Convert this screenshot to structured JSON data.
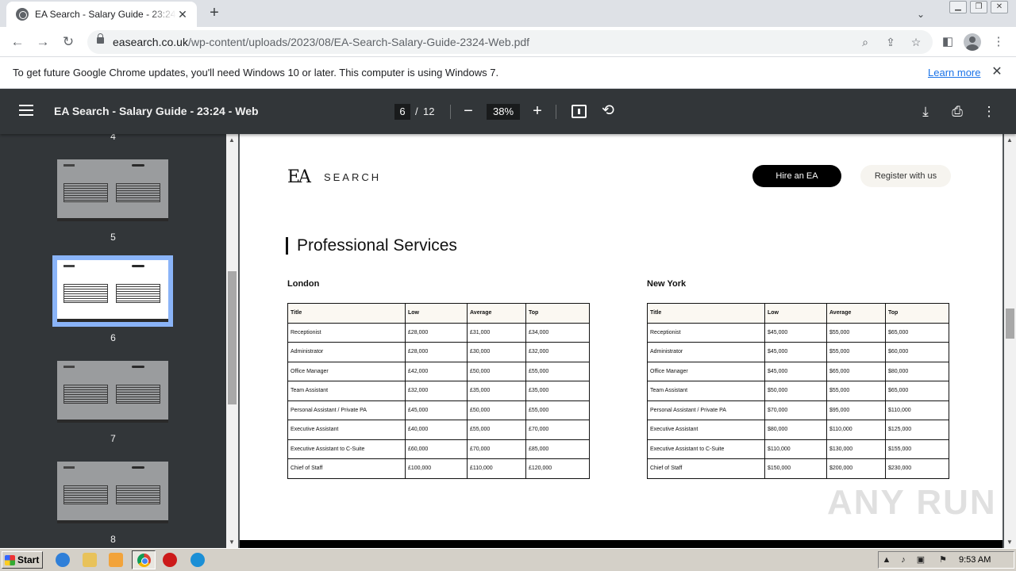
{
  "browser": {
    "tab_title": "EA Search - Salary Guide - 23:24 - Web",
    "tab_close": "✕",
    "new_tab": "+",
    "url_host": "easearch.co.uk",
    "url_path": "/wp-content/uploads/2023/08/EA-Search-Salary-Guide-2324-Web.pdf"
  },
  "infobar": {
    "message": "To get future Google Chrome updates, you'll need Windows 10 or later. This computer is using Windows 7.",
    "link": "Learn more"
  },
  "pdf_toolbar": {
    "title": "EA Search - Salary Guide - 23:24 - Web",
    "current_page": "6",
    "page_sep": "/",
    "total_pages": "12",
    "zoom": "38%",
    "zoom_out": "−",
    "zoom_in": "+"
  },
  "sidebar": {
    "thumbs": [
      {
        "label": "4"
      },
      {
        "label": "5"
      },
      {
        "label": "6"
      },
      {
        "label": "7"
      },
      {
        "label": "8"
      }
    ],
    "selected": "6"
  },
  "page": {
    "brand_mark": "EA",
    "brand_name": "SEARCH",
    "hire_button": "Hire an EA",
    "register_button": "Register with us",
    "section_title": "Professional Services",
    "tables": [
      {
        "city": "London",
        "headers": [
          "Title",
          "Low",
          "Average",
          "Top"
        ],
        "rows": [
          [
            "Receptionist",
            "£28,000",
            "£31,000",
            "£34,000"
          ],
          [
            "Administrator",
            "£28,000",
            "£30,000",
            "£32,000"
          ],
          [
            "Office Manager",
            "£42,000",
            "£50,000",
            "£55,000"
          ],
          [
            "Team Assistant",
            "£32,000",
            "£35,000",
            "£35,000"
          ],
          [
            "Personal Assistant / Private PA",
            "£45,000",
            "£50,000",
            "£55,000"
          ],
          [
            "Executive Assistant",
            "£40,000",
            "£55,000",
            "£70,000"
          ],
          [
            "Executive Assistant to C-Suite",
            "£60,000",
            "£70,000",
            "£85,000"
          ],
          [
            "Chief of Staff",
            "£100,000",
            "£110,000",
            "£120,000"
          ]
        ]
      },
      {
        "city": "New York",
        "headers": [
          "Title",
          "Low",
          "Average",
          "Top"
        ],
        "rows": [
          [
            "Receptionist",
            "$45,000",
            "$55,000",
            "$65,000"
          ],
          [
            "Administrator",
            "$45,000",
            "$55,000",
            "$60,000"
          ],
          [
            "Office Manager",
            "$45,000",
            "$65,000",
            "$80,000"
          ],
          [
            "Team Assistant",
            "$50,000",
            "$55,000",
            "$65,000"
          ],
          [
            "Personal Assistant / Private PA",
            "$70,000",
            "$95,000",
            "$110,000"
          ],
          [
            "Executive Assistant",
            "$80,000",
            "$110,000",
            "$125,000"
          ],
          [
            "Executive Assistant to C-Suite",
            "$110,000",
            "$130,000",
            "$155,000"
          ],
          [
            "Chief of Staff",
            "$150,000",
            "$200,000",
            "$230,000"
          ]
        ]
      }
    ],
    "watermark": "ANY RUN"
  },
  "taskbar": {
    "start": "Start",
    "clock": "9:53 AM"
  }
}
